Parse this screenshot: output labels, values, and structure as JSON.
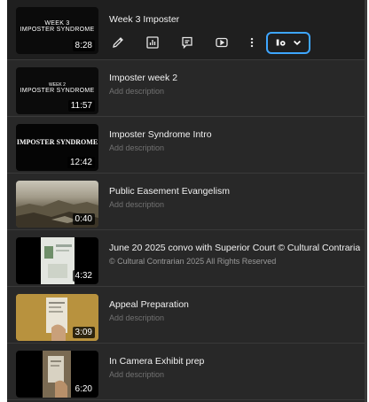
{
  "videos": [
    {
      "title": "Week 3 Imposter",
      "description": "",
      "duration": "8:28",
      "thumb_lines": [
        "WEEK 3",
        "IMPOSTER SYNDROME"
      ]
    },
    {
      "title": "Imposter week 2",
      "description": "Add description",
      "duration": "11:57",
      "thumb_lines": [
        "WEEK 2",
        "IMPOSTER SYNDROME"
      ]
    },
    {
      "title": "Imposter Syndrome Intro",
      "description": "Add description",
      "duration": "12:42",
      "thumb_lines": [
        "IMPOSTER SYNDROME"
      ]
    },
    {
      "title": "Public Easement Evangelism",
      "description": "Add description",
      "duration": "0:40",
      "thumb_lines": []
    },
    {
      "title": "June 20 2025 convo with Superior Court © Cultural Contrarian",
      "description": "© Cultural Contrarian 2025 All Rights Reserved",
      "duration": "4:32",
      "thumb_lines": []
    },
    {
      "title": "Appeal Preparation",
      "description": "Add description",
      "duration": "3:09",
      "thumb_lines": []
    },
    {
      "title": "In Camera Exhibit prep",
      "description": "Add description",
      "duration": "6:20",
      "thumb_lines": []
    }
  ],
  "actions": {
    "edit": "pencil-icon",
    "analytics": "analytics-icon",
    "comments": "comments-icon",
    "youtube": "youtube-play-icon",
    "options": "more-vertical-icon",
    "visibility": "visibility-dropdown"
  },
  "colors": {
    "panel_bg": "#282828",
    "active_row_bg": "#1f1f1f",
    "accent": "#3ea6ff",
    "title": "#f1f1f1",
    "muted": "#717171"
  }
}
